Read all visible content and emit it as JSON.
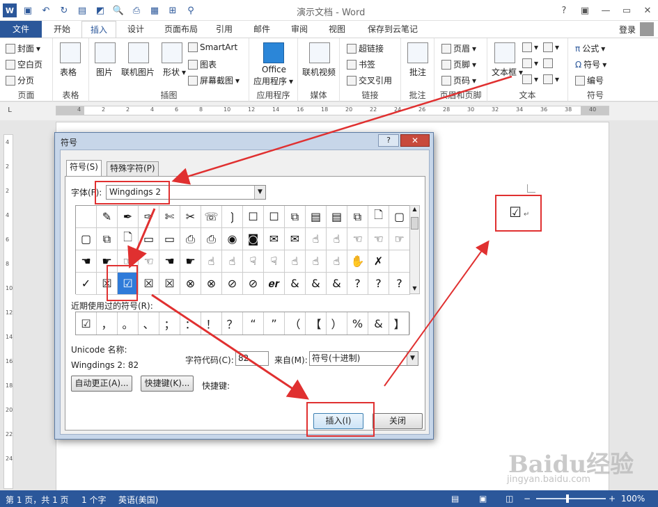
{
  "window": {
    "title": "演示文档 - Word",
    "help": "?",
    "minimize": "—",
    "restore": "▭",
    "close": "✕"
  },
  "qat_icons": [
    "word-logo",
    "save-icon",
    "undo-icon",
    "redo-icon",
    "save2-icon",
    "new-icon",
    "preview-icon",
    "print-icon",
    "table-icon",
    "more-icon",
    "find-icon"
  ],
  "tabs": [
    "文件",
    "开始",
    "插入",
    "设计",
    "页面布局",
    "引用",
    "邮件",
    "审阅",
    "视图",
    "保存到云笔记"
  ],
  "active_tab": "插入",
  "login": "登录",
  "ribbon": {
    "pages": {
      "label": "页面",
      "items": [
        "封面",
        "空白页",
        "分页"
      ]
    },
    "tables": {
      "label": "表格",
      "items": [
        "表格"
      ]
    },
    "illustrations": {
      "label": "插图",
      "items": [
        "图片",
        "联机图片",
        "形状",
        "SmartArt",
        "图表",
        "屏幕截图"
      ]
    },
    "apps": {
      "label": "应用程序",
      "items": [
        "Office",
        "应用程序"
      ]
    },
    "media": {
      "label": "媒体",
      "items": [
        "联机视频"
      ]
    },
    "links": {
      "label": "链接",
      "items": [
        "超链接",
        "书签",
        "交叉引用"
      ]
    },
    "comments": {
      "label": "批注",
      "items": [
        "批注"
      ]
    },
    "header_footer": {
      "label": "页眉和页脚",
      "items": [
        "页眉",
        "页脚",
        "页码"
      ]
    },
    "text": {
      "label": "文本",
      "items": [
        "文本框"
      ]
    },
    "symbols": {
      "label": "符号",
      "items": [
        "公式",
        "符号",
        "编号"
      ]
    }
  },
  "ruler_numbers": [
    "4",
    "2",
    "2",
    "4",
    "6",
    "8",
    "10",
    "12",
    "14",
    "16",
    "18",
    "20",
    "22",
    "24",
    "26",
    "28",
    "30",
    "32",
    "34",
    "36",
    "38",
    "40"
  ],
  "vruler_numbers": [
    "4",
    "2",
    "2",
    "4",
    "6",
    "8",
    "10",
    "12",
    "14",
    "16",
    "18",
    "20",
    "22",
    "24"
  ],
  "document": {
    "inserted_symbol": "☑",
    "para_mark": "↵"
  },
  "dialog": {
    "title": "符号",
    "help": "?",
    "close": "✕",
    "tabs": [
      "符号(S)",
      "特殊字符(P)"
    ],
    "font_label": "字体(F):",
    "font_value": "Wingdings 2",
    "symbols": [
      "",
      "✎",
      "✒",
      "✑",
      "✄",
      "✂",
      "☏",
      "❳",
      "☐",
      "☐",
      "⧉",
      "▤",
      "▤",
      "⧉",
      "🗋",
      "▢",
      "▢",
      "⧉",
      "🗋",
      "▭",
      "▭",
      "⎙",
      "⎙",
      "◉",
      "◙",
      "✉",
      "✉",
      "☝",
      "☝",
      "☜",
      "☜",
      "☞",
      "☚",
      "☛",
      "☞",
      "☜",
      "☚",
      "☛",
      "☝",
      "☝",
      "☟",
      "☟",
      "☝",
      "☝",
      "☝",
      "✋",
      "✗",
      "",
      "✓",
      "☒",
      "☑",
      "☒",
      "☒",
      "⊗",
      "⊗",
      "⊘",
      "⊘",
      "𝒆𝒓",
      "&",
      "&",
      "&",
      "?",
      "?",
      "?"
    ],
    "selected_index": 50,
    "recent_label": "近期使用过的符号(R):",
    "recent": [
      "☑",
      "，",
      "。",
      "、",
      "；",
      "：",
      "！",
      "？",
      "“",
      "”",
      "（",
      "【",
      "）",
      "%",
      "&",
      "】"
    ],
    "unicode_label": "Unicode 名称:",
    "unicode_value": "Wingdings 2: 82",
    "code_label": "字符代码(C):",
    "code_value": "82",
    "from_label": "来自(M):",
    "from_value": "符号(十进制)",
    "autocorrect": "自动更正(A)...",
    "shortcut_btn": "快捷键(K)...",
    "shortcut_label": "快捷键:",
    "insert": "插入(I)",
    "cancel": "关闭"
  },
  "status": {
    "page": "第 1 页，共 1 页",
    "words": "1 个字",
    "lang": "英语(美国)",
    "zoom": "100%"
  },
  "watermark": {
    "brand": "Baidu经验",
    "url": "jingyan.baidu.com"
  },
  "colors": {
    "accent": "#2b579a",
    "highlight": "#e03030",
    "selected": "#2f7bd9"
  }
}
